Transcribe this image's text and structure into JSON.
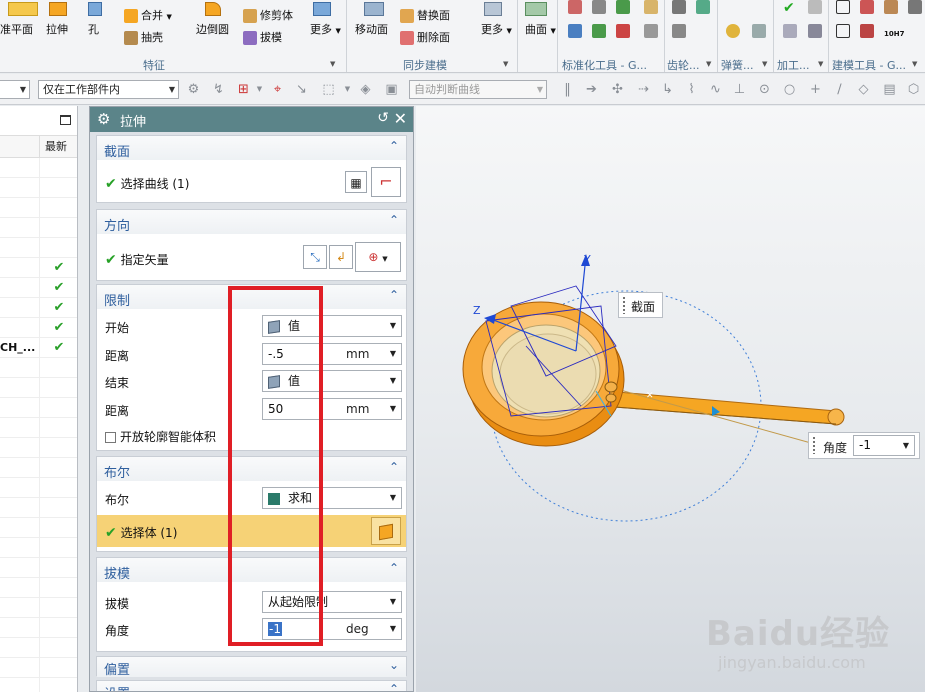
{
  "ribbon": {
    "buttons": {
      "datum_plane": "准平面",
      "extrude": "拉伸",
      "hole": "孔",
      "unite": "合并",
      "shell": "抽壳",
      "edge_blend": "边倒圆",
      "trim_body": "修剪体",
      "draft": "拔模",
      "more1": "更多",
      "move_face": "移动面",
      "replace_face": "替换面",
      "delete_face": "删除面",
      "more2": "更多",
      "surface": "曲面"
    },
    "groups": {
      "feature": "特征",
      "sync_modeling": "同步建模",
      "standard_parts": "标准化工具 - G...",
      "gear": "齿轮...",
      "spring": "弹簧...",
      "machining": "加工...",
      "modeling_tools": "建模工具 - G..."
    },
    "small_icon_text": "10H7"
  },
  "filterbar": {
    "type_filter": "",
    "scope_filter": "仅在工作部件内",
    "curve_rule": "自动判断曲线"
  },
  "navigator": {
    "column_latest": "最新",
    "rows": [
      {
        "name": "",
        "latest": ""
      },
      {
        "name": "",
        "latest": ""
      },
      {
        "name": "",
        "latest": ""
      },
      {
        "name": "",
        "latest": ""
      },
      {
        "name": "",
        "latest": ""
      },
      {
        "name": "",
        "latest": "✔"
      },
      {
        "name": "",
        "latest": "✔"
      },
      {
        "name": "",
        "latest": "✔"
      },
      {
        "name": "",
        "latest": "✔"
      },
      {
        "name": "CH_...",
        "latest": "✔"
      },
      {
        "name": "",
        "latest": ""
      },
      {
        "name": "",
        "latest": ""
      },
      {
        "name": "",
        "latest": ""
      },
      {
        "name": "",
        "latest": ""
      },
      {
        "name": "",
        "latest": ""
      },
      {
        "name": "",
        "latest": ""
      },
      {
        "name": "",
        "latest": ""
      },
      {
        "name": "",
        "latest": ""
      },
      {
        "name": "",
        "latest": ""
      },
      {
        "name": "",
        "latest": ""
      },
      {
        "name": "",
        "latest": ""
      },
      {
        "name": "",
        "latest": ""
      },
      {
        "name": "",
        "latest": ""
      },
      {
        "name": "",
        "latest": ""
      },
      {
        "name": "",
        "latest": ""
      },
      {
        "name": "",
        "latest": ""
      },
      {
        "name": "",
        "latest": ""
      }
    ]
  },
  "dialog": {
    "title": "拉伸",
    "section": {
      "label": "截面",
      "select_curve": "选择曲线 (1)"
    },
    "direction": {
      "label": "方向",
      "specify_vector": "指定矢量"
    },
    "limits": {
      "label": "限制",
      "start_label": "开始",
      "start_value": "值",
      "start_distance_label": "距离",
      "start_distance": "-.5",
      "start_unit": "mm",
      "end_label": "结束",
      "end_value": "值",
      "end_distance_label": "距离",
      "end_distance": "50",
      "end_unit": "mm",
      "open_profile": "开放轮廓智能体积"
    },
    "boolean": {
      "label": "布尔",
      "boolean_label": "布尔",
      "boolean_value": "求和",
      "select_body": "选择体 (1)"
    },
    "draft": {
      "label": "拔模",
      "draft_label": "拔模",
      "draft_value": "从起始限制",
      "angle_label": "角度",
      "angle_value": "-1",
      "angle_unit": "deg"
    },
    "offset": {
      "label": "偏置"
    },
    "settings": {
      "label": "设置"
    }
  },
  "viewport": {
    "section_tag": "截面",
    "angle_label": "角度",
    "angle_value": "-1",
    "axis_y": "Y",
    "axis_z": "Z",
    "watermark_brand": "Baidu经验",
    "watermark_url": "jingyan.baidu.com"
  },
  "colors": {
    "title_bar": "#5b8489",
    "section_header": "#2f5f9e",
    "highlight": "#f6d276",
    "red_box": "#e01e25",
    "model_orange": "#f5a623",
    "check_green": "#27a127"
  }
}
